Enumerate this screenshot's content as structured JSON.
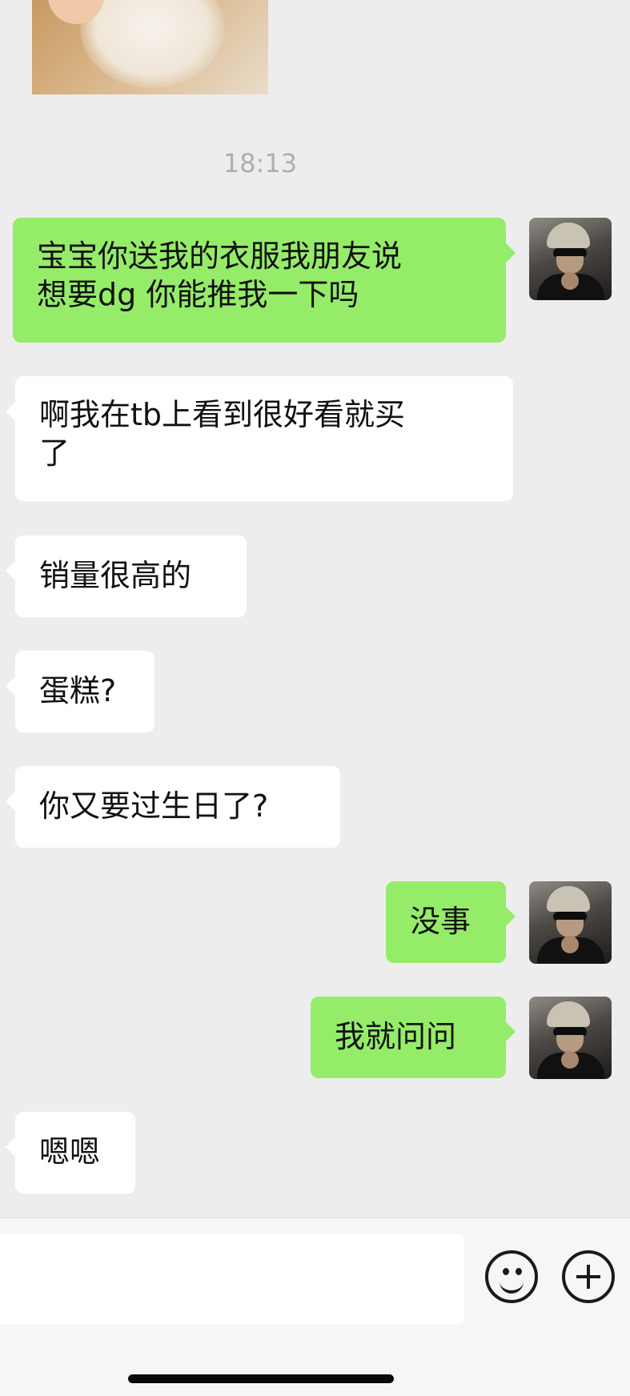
{
  "chat": {
    "timestamp": "18:13",
    "messages": [
      {
        "side": "out",
        "text": "宝宝你送我的衣服我朋友说\n想要dg 你能推我一下吗"
      },
      {
        "side": "in",
        "text": "啊我在tb上看到很好看就买\n了"
      },
      {
        "side": "in",
        "text": "销量很高的"
      },
      {
        "side": "in",
        "text": "蛋糕?"
      },
      {
        "side": "in",
        "text": "你又要过生日了?"
      },
      {
        "side": "out",
        "text": "没事"
      },
      {
        "side": "out",
        "text": "我就问问"
      },
      {
        "side": "in",
        "text": "嗯嗯"
      }
    ]
  },
  "input_bar": {
    "placeholder": "",
    "emoji_icon": "smiley-icon",
    "more_icon": "plus-circle-icon"
  },
  "colors": {
    "background": "#ededed",
    "outgoing_bubble": "#95ec69",
    "incoming_bubble": "#ffffff"
  }
}
